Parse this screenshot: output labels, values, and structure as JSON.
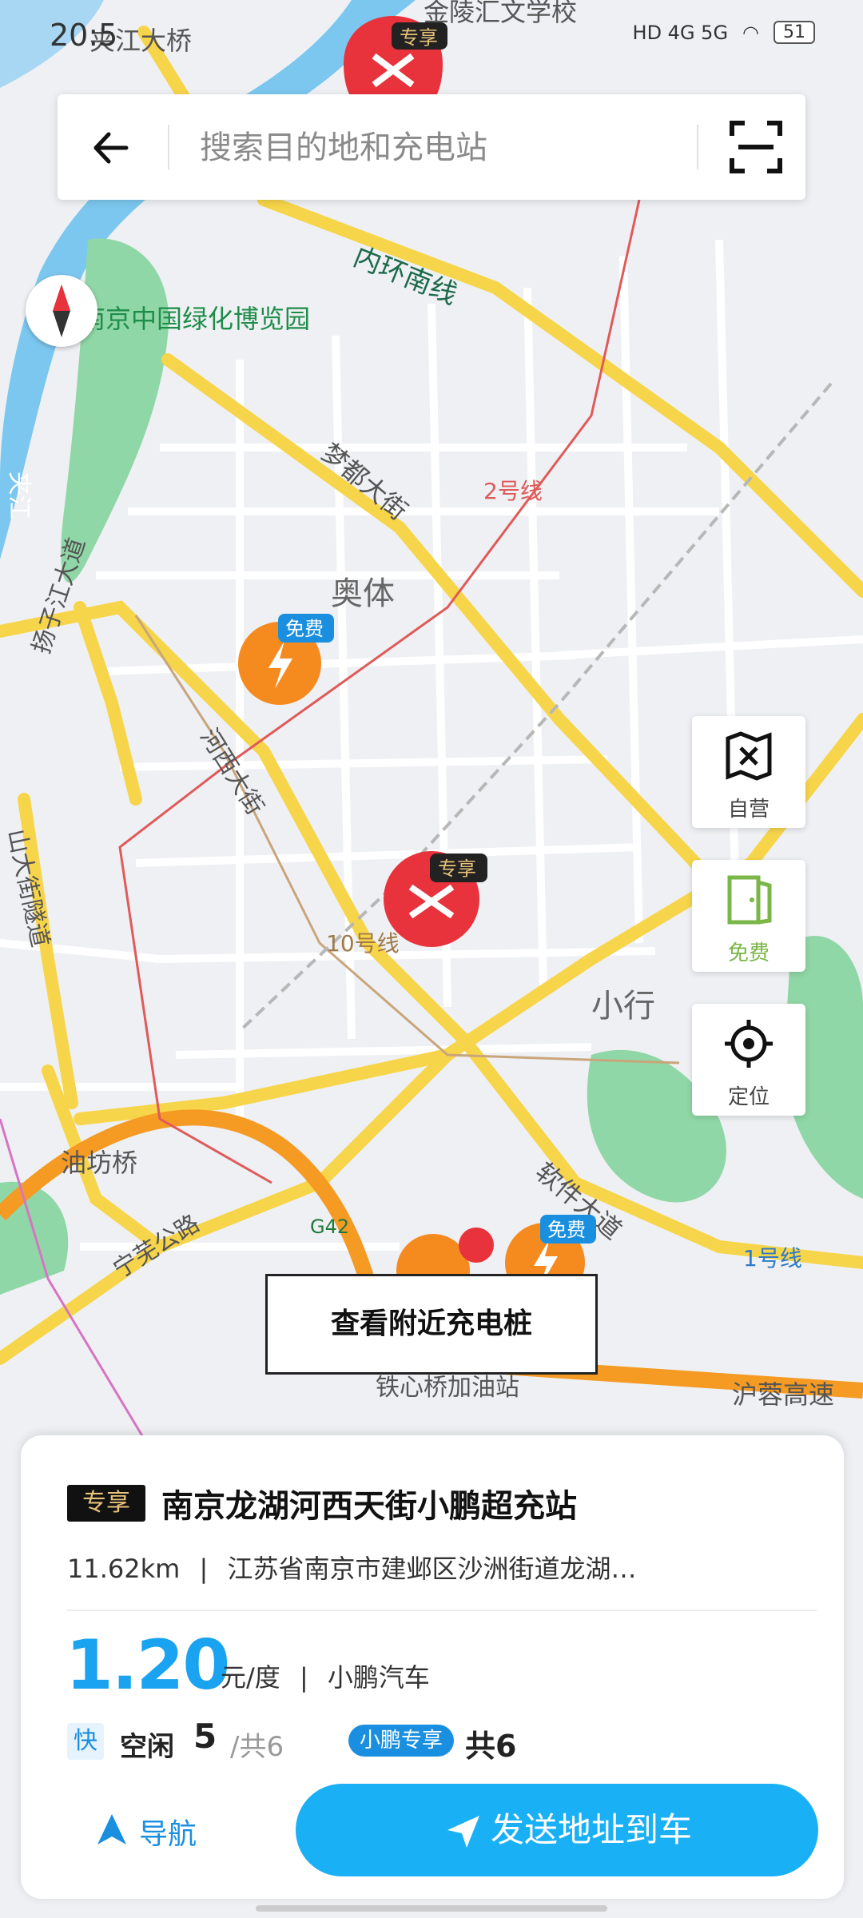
{
  "status_bar": {
    "time": "20:5",
    "network": "HD 4G 5G",
    "battery": "51"
  },
  "search": {
    "placeholder": "搜索目的地和充电站"
  },
  "map": {
    "labels": {
      "bridge": "夹江大桥",
      "school": "金陵汇文学校",
      "ring_road": "内环南线",
      "expo": "南京中国绿化博览园",
      "jiajiang": "夹江",
      "mengdu": "梦都大街",
      "line2": "2号线",
      "olympic": "奥体",
      "yangzijiang": "扬子江大道",
      "hexi": "河西大街",
      "tunnel": "山大街隧道",
      "line10": "10号线",
      "xiaohang": "小行",
      "youfang": "油坊桥",
      "ningwu": "宁芜公路",
      "g42": "G42",
      "software": "软件大道",
      "line1": "1号线",
      "tiexin": "铁心桥加油站",
      "hurong": "沪蓉高速"
    },
    "pin_badges": {
      "exclusive": "专享",
      "free": "免费"
    }
  },
  "side_buttons": {
    "self_run": "自营",
    "free": "免费",
    "locate": "定位"
  },
  "nearby_button": "查看附近充电桩",
  "station": {
    "tag": "专享",
    "name": "南京龙湖河西天街小鹏超充站",
    "distance": "11.62km",
    "separator": "|",
    "address": "江苏省南京市建邺区沙洲街道龙湖…",
    "price": "1.20",
    "price_unit": "元/度",
    "operator": "小鹏汽车",
    "speed_tag": "快",
    "idle_label": "空闲",
    "idle_count": "5",
    "idle_total": "/共6",
    "brand_badge": "小鹏专享",
    "total": "共6"
  },
  "actions": {
    "navigate": "导航",
    "send": "发送地址到车"
  },
  "colors": {
    "accent": "#1ab0f5",
    "exclusive_pin": "#e8323c",
    "free_pin": "#f58a1f",
    "road_major": "#f7d54a"
  }
}
